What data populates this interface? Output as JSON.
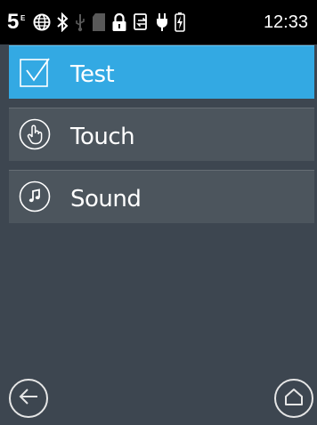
{
  "status_bar": {
    "network_label": "5",
    "network_sub": "E",
    "time": "12:33",
    "icons": [
      "network-5e-icon",
      "globe-icon",
      "bluetooth-icon",
      "usb-icon",
      "sd-card-icon",
      "lock-icon",
      "sync-icon",
      "power-plug-icon",
      "battery-icon"
    ]
  },
  "menu": {
    "items": [
      {
        "label": "Test",
        "icon": "checkbox-icon",
        "selected": true
      },
      {
        "label": "Touch",
        "icon": "touch-hand-icon",
        "selected": false
      },
      {
        "label": "Sound",
        "icon": "music-note-icon",
        "selected": false
      }
    ]
  },
  "nav": {
    "back_icon": "back-arrow-icon",
    "home_icon": "home-icon"
  },
  "colors": {
    "background": "#3d4650",
    "item_bg": "#4c555d",
    "selected_bg": "#33a9e3",
    "status_bar_bg": "#000000"
  }
}
